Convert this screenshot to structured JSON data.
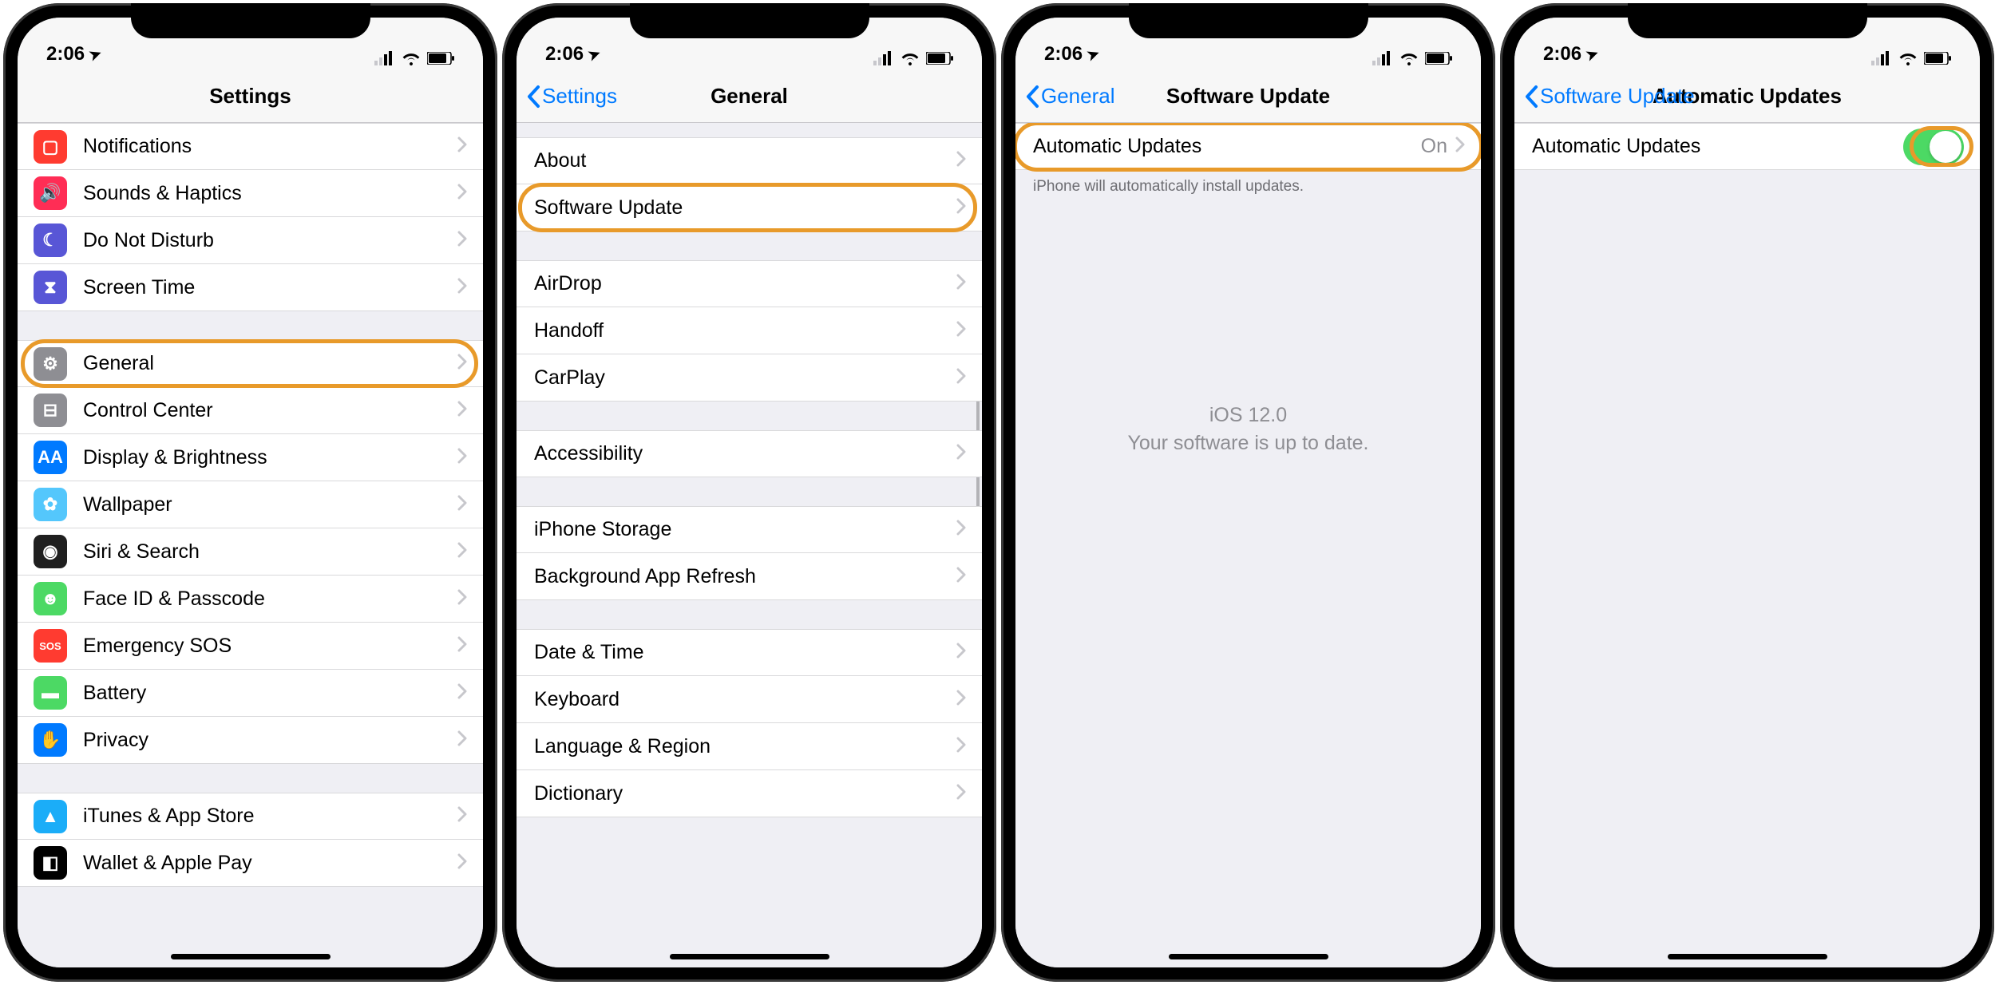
{
  "status": {
    "time": "2:06",
    "location_glyph": "➤"
  },
  "colors": {
    "highlight": "#e89a2a",
    "link": "#007aff",
    "toggle_on": "#4cd964"
  },
  "phone1": {
    "nav_title": "Settings",
    "sections": [
      {
        "rows": [
          {
            "label": "Notifications",
            "icon_bg": "#ff3b30",
            "icon": "notifications-icon",
            "glyph": "▢"
          },
          {
            "label": "Sounds & Haptics",
            "icon_bg": "#ff2d55",
            "icon": "sounds-icon",
            "glyph": "🔊"
          },
          {
            "label": "Do Not Disturb",
            "icon_bg": "#5856d6",
            "icon": "moon-icon",
            "glyph": "☾"
          },
          {
            "label": "Screen Time",
            "icon_bg": "#5856d6",
            "icon": "hourglass-icon",
            "glyph": "⧗"
          }
        ]
      },
      {
        "rows": [
          {
            "label": "General",
            "icon_bg": "#8e8e93",
            "icon": "gear-icon",
            "glyph": "⚙",
            "highlighted": true
          },
          {
            "label": "Control Center",
            "icon_bg": "#8e8e93",
            "icon": "switches-icon",
            "glyph": "⊟"
          },
          {
            "label": "Display & Brightness",
            "icon_bg": "#007aff",
            "icon": "text-size-icon",
            "glyph": "AA"
          },
          {
            "label": "Wallpaper",
            "icon_bg": "#54c7fc",
            "icon": "wallpaper-icon",
            "glyph": "✿"
          },
          {
            "label": "Siri & Search",
            "icon_bg": "#1f1f1f",
            "icon": "siri-icon",
            "glyph": "◉"
          },
          {
            "label": "Face ID & Passcode",
            "icon_bg": "#4cd964",
            "icon": "faceid-icon",
            "glyph": "☻"
          },
          {
            "label": "Emergency SOS",
            "icon_bg": "#ff3b30",
            "icon": "sos-icon",
            "glyph": "SOS"
          },
          {
            "label": "Battery",
            "icon_bg": "#4cd964",
            "icon": "battery-icon",
            "glyph": "▬"
          },
          {
            "label": "Privacy",
            "icon_bg": "#007aff",
            "icon": "hand-icon",
            "glyph": "✋"
          }
        ]
      },
      {
        "rows": [
          {
            "label": "iTunes & App Store",
            "icon_bg": "#1badf8",
            "icon": "appstore-icon",
            "glyph": "▲"
          },
          {
            "label": "Wallet & Apple Pay",
            "icon_bg": "#000000",
            "icon": "wallet-icon",
            "glyph": "◧"
          }
        ]
      }
    ]
  },
  "phone2": {
    "nav_back": "Settings",
    "nav_title": "General",
    "sections": [
      {
        "rows": [
          {
            "label": "About"
          },
          {
            "label": "Software Update",
            "highlighted": true
          }
        ]
      },
      {
        "rows": [
          {
            "label": "AirDrop"
          },
          {
            "label": "Handoff"
          },
          {
            "label": "CarPlay"
          }
        ]
      },
      {
        "rows": [
          {
            "label": "Accessibility"
          }
        ]
      },
      {
        "rows": [
          {
            "label": "iPhone Storage"
          },
          {
            "label": "Background App Refresh"
          }
        ]
      },
      {
        "rows": [
          {
            "label": "Date & Time"
          },
          {
            "label": "Keyboard"
          },
          {
            "label": "Language & Region"
          },
          {
            "label": "Dictionary"
          }
        ]
      }
    ]
  },
  "phone3": {
    "nav_back": "General",
    "nav_title": "Software Update",
    "row_label": "Automatic Updates",
    "row_value": "On",
    "footer": "iPhone will automatically install updates.",
    "status_line1": "iOS 12.0",
    "status_line2": "Your software is up to date."
  },
  "phone4": {
    "nav_back": "Software Update",
    "nav_title": "Automatic Updates",
    "row_label": "Automatic Updates",
    "toggle_on": true
  }
}
